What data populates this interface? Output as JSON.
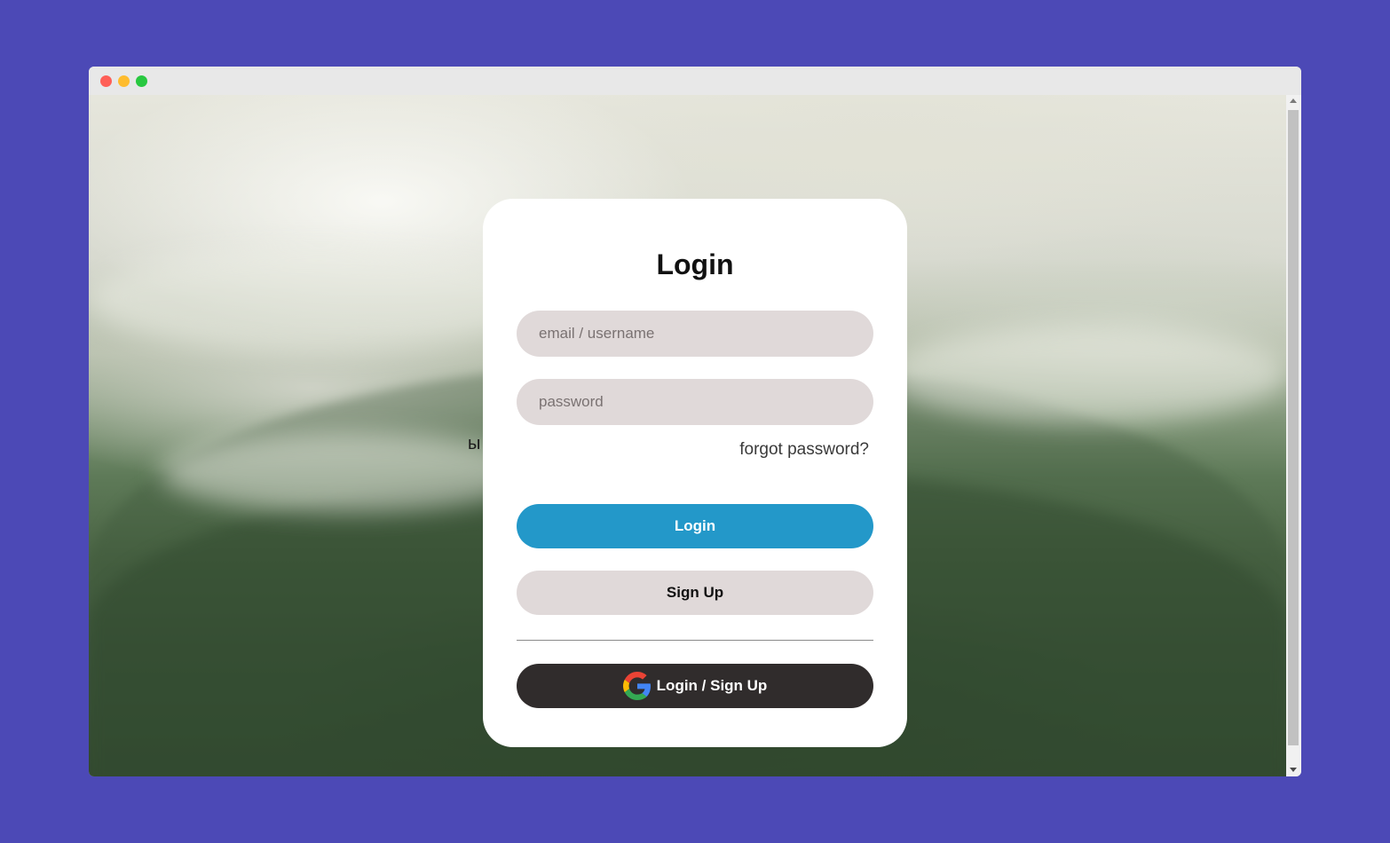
{
  "colors": {
    "page_background": "#4c49b6",
    "login_button": "#2398c9",
    "input_background": "#e0d9d9",
    "google_button": "#302c2c"
  },
  "window": {
    "controls": [
      "close",
      "minimize",
      "maximize"
    ]
  },
  "background_text": "ы",
  "login_card": {
    "title": "Login",
    "email_placeholder": "email / username",
    "password_placeholder": "password",
    "forgot_link": "forgot password?",
    "login_button": "Login",
    "signup_button": "Sign Up",
    "google_button": "Login / Sign Up",
    "google_icon": "google-g-logo"
  }
}
